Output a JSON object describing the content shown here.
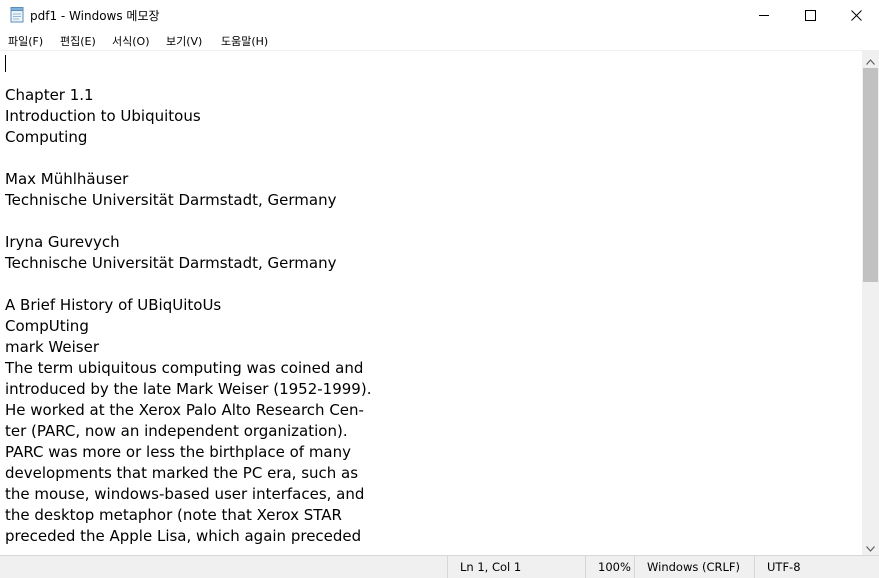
{
  "window": {
    "title": "pdf1 - Windows 메모장",
    "app_icon": "notepad-icon",
    "controls": {
      "minimize_icon": "minimize-icon",
      "maximize_icon": "maximize-icon",
      "close_icon": "close-icon"
    }
  },
  "menubar": {
    "items": [
      {
        "label": "파일(F)"
      },
      {
        "label": "편집(E)"
      },
      {
        "label": "서식(O)"
      },
      {
        "label": "보기(V)"
      },
      {
        "label": "도움말(H)"
      }
    ]
  },
  "editor": {
    "lines": [
      "",
      "",
      "Chapter 1.1",
      "Introduction to Ubiquitous",
      "Computing",
      "",
      "Max Mühlhäuser",
      "Technische Universität Darmstadt, Germany",
      "",
      "Iryna Gurevych",
      "Technische Universität Darmstadt, Germany",
      "",
      "A Brief History of UBiqUitoUs",
      "CompUting",
      "mark Weiser",
      "The term ubiquitous computing was coined and",
      "introduced by the late Mark Weiser (1952-1999).",
      "He worked at the Xerox Palo Alto Research Cen-",
      "ter (PARC, now an independent organization).",
      "PARC was more or less the birthplace of many",
      "developments that marked the PC era, such as",
      "the mouse, windows-based user interfaces, and",
      "the desktop metaphor (note that Xerox STAR",
      "preceded the Apple Lisa, which again preceded"
    ]
  },
  "scrollbar": {
    "up_icon": "scroll-up-arrow-icon",
    "down_icon": "scroll-down-arrow-icon"
  },
  "statusbar": {
    "position": "Ln 1, Col 1",
    "zoom": "100%",
    "line_ending": "Windows (CRLF)",
    "encoding": "UTF-8"
  }
}
